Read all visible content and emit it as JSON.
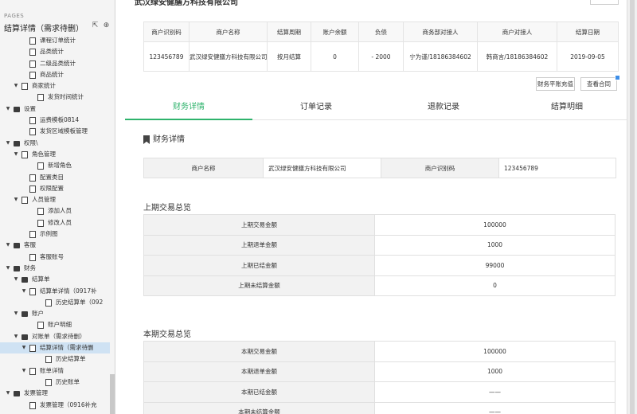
{
  "sidebar": {
    "section_label": "PAGES",
    "title": "结算详情（需求待删）",
    "tree": [
      {
        "level": 4,
        "type": "page",
        "arrow": "",
        "label": "课程订单统计"
      },
      {
        "level": 4,
        "type": "page",
        "arrow": "",
        "label": "品类统计"
      },
      {
        "level": 4,
        "type": "page",
        "arrow": "",
        "label": "二级品类统计"
      },
      {
        "level": 4,
        "type": "page",
        "arrow": "",
        "label": "商品统计"
      },
      {
        "level": 3,
        "type": "page",
        "arrow": "▼",
        "label": "商家统计"
      },
      {
        "level": 5,
        "type": "page",
        "arrow": "",
        "label": "发货时间统计"
      },
      {
        "level": 2,
        "type": "folder",
        "arrow": "▼",
        "label": "设置"
      },
      {
        "level": 4,
        "type": "page",
        "arrow": "",
        "label": "运费模板0814"
      },
      {
        "level": 4,
        "type": "page",
        "arrow": "",
        "label": "发货区域模板管理"
      },
      {
        "level": 2,
        "type": "folder",
        "arrow": "▼",
        "label": "权限\\"
      },
      {
        "level": 3,
        "type": "page",
        "arrow": "▼",
        "label": "角色管理"
      },
      {
        "level": 5,
        "type": "page",
        "arrow": "",
        "label": "新增角色"
      },
      {
        "level": 4,
        "type": "page",
        "arrow": "",
        "label": "配置类目"
      },
      {
        "level": 4,
        "type": "page",
        "arrow": "",
        "label": "权限配置"
      },
      {
        "level": 3,
        "type": "page",
        "arrow": "▼",
        "label": "人员管理"
      },
      {
        "level": 5,
        "type": "page",
        "arrow": "",
        "label": "添加人员"
      },
      {
        "level": 5,
        "type": "page",
        "arrow": "",
        "label": "修改人员"
      },
      {
        "level": 4,
        "type": "page",
        "arrow": "",
        "label": "示例图"
      },
      {
        "level": 2,
        "type": "folder",
        "arrow": "▼",
        "label": "客服"
      },
      {
        "level": 4,
        "type": "page",
        "arrow": "",
        "label": "客服账号"
      },
      {
        "level": 2,
        "type": "folder",
        "arrow": "▼",
        "label": "财务"
      },
      {
        "level": 3,
        "type": "folder",
        "arrow": "▼",
        "label": "结算单"
      },
      {
        "level": 4,
        "type": "page",
        "arrow": "▼",
        "label": "结算单详情（0917补"
      },
      {
        "level": 6,
        "type": "page",
        "arrow": "",
        "label": "历史结算单（092"
      },
      {
        "level": 3,
        "type": "folder",
        "arrow": "▼",
        "label": "账户"
      },
      {
        "level": 5,
        "type": "page",
        "arrow": "",
        "label": "账户明细"
      },
      {
        "level": 3,
        "type": "folder",
        "arrow": "▼",
        "label": "对账单（需求待删）"
      },
      {
        "level": 4,
        "type": "page",
        "arrow": "▼",
        "label": "结算详情（需求待删",
        "selected": true
      },
      {
        "level": 6,
        "type": "page",
        "arrow": "",
        "label": "历史结算单"
      },
      {
        "level": 4,
        "type": "page",
        "arrow": "▼",
        "label": "账单详情"
      },
      {
        "level": 6,
        "type": "page",
        "arrow": "",
        "label": "历史账单"
      },
      {
        "level": 2,
        "type": "folder",
        "arrow": "▼",
        "label": "发票管理"
      },
      {
        "level": 4,
        "type": "page",
        "arrow": "",
        "label": "发票管理（0916补充"
      }
    ]
  },
  "header": {
    "company_name": "武汉绿安健膳方科技有限公司"
  },
  "info_table": {
    "headers": [
      "商户识别码",
      "商户名称",
      "结算周期",
      "账户余额",
      "负债",
      "商务部对接人",
      "商户对接人",
      "结算日期"
    ],
    "row": [
      "123456789",
      "武汉绿安健膳方科技有限公司",
      "按月结算",
      "0",
      "- 2000",
      "宁为谨/18186384602",
      "韩商言/18186384602",
      "2019-09-05"
    ]
  },
  "actions": {
    "balance_recharge": "财务平账充值",
    "view_contract": "查看合同"
  },
  "tabs": [
    {
      "label": "财务详情",
      "active": true
    },
    {
      "label": "订单记录",
      "active": false
    },
    {
      "label": "退款记录",
      "active": false
    },
    {
      "label": "结算明细",
      "active": false
    }
  ],
  "finance": {
    "heading": "财务详情",
    "merchant_name_label": "商户名称",
    "merchant_name_value": "武汉绿安健膳方科技有限公司",
    "merchant_id_label": "商户识别码",
    "merchant_id_value": "123456789"
  },
  "previous_period": {
    "title": "上期交易总览",
    "rows": [
      {
        "label": "上期交易金额",
        "value": "100000"
      },
      {
        "label": "上期退单金额",
        "value": "1000"
      },
      {
        "label": "上期已结金额",
        "value": "99000"
      },
      {
        "label": "上期未结算金额",
        "value": "0"
      }
    ]
  },
  "current_period": {
    "title": "本期交易总览",
    "rows": [
      {
        "label": "本期交易金额",
        "value": "100000"
      },
      {
        "label": "本期退单金额",
        "value": "1000"
      },
      {
        "label": "本期已结金额",
        "value": "——"
      },
      {
        "label": "本期未结算金额",
        "value": "——"
      }
    ]
  },
  "colors": {
    "accent_green": "#2fb36c",
    "selection_blue": "#cfe2f3",
    "marker_blue": "#3d8ee8"
  }
}
